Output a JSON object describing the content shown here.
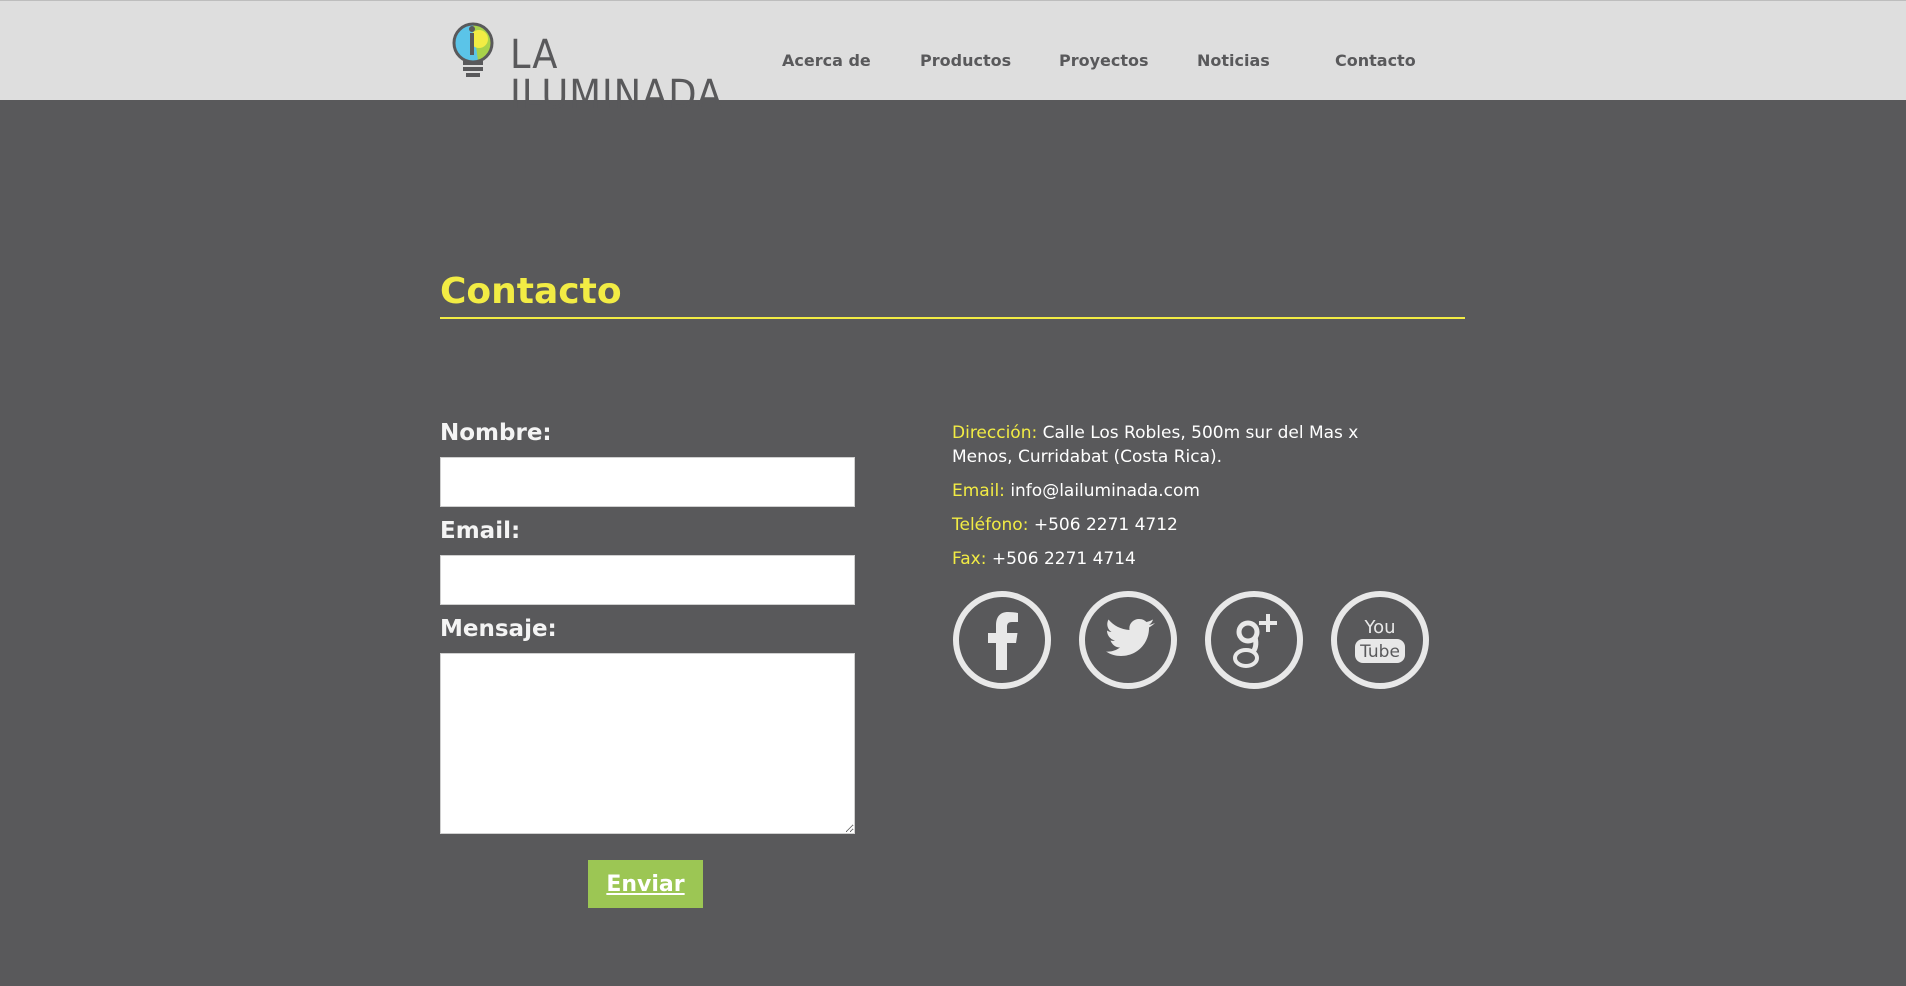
{
  "brand": {
    "name": "LA ILUMINADA",
    "colors": {
      "accent": "#f2ec44",
      "button": "#9cc654",
      "background": "#59595b",
      "header": "#dedede"
    }
  },
  "nav": {
    "items": [
      {
        "label": "Acerca de"
      },
      {
        "label": "Productos"
      },
      {
        "label": "Proyectos"
      },
      {
        "label": "Noticias"
      },
      {
        "label": "Contacto"
      }
    ]
  },
  "contact": {
    "title": "Contacto",
    "form": {
      "name_label": "Nombre:",
      "email_label": "Email:",
      "message_label": "Mensaje:",
      "name_value": "",
      "email_value": "",
      "message_value": "",
      "submit_label": "Enviar"
    },
    "info": {
      "address_label": "Dirección:",
      "address_value": "Calle Los Robles, 500m sur del Mas x Menos, Curridabat (Costa Rica).",
      "email_label": "Email:",
      "email_value": "info@lailuminada.com",
      "phone_label": "Teléfono:",
      "phone_value": "+506 2271 4712",
      "fax_label": "Fax:",
      "fax_value": "+506 2271 4714"
    },
    "social": [
      {
        "icon": "facebook-icon"
      },
      {
        "icon": "twitter-icon"
      },
      {
        "icon": "google-plus-icon"
      },
      {
        "icon": "youtube-icon",
        "text_top": "You",
        "text_bottom": "Tube"
      }
    ]
  }
}
